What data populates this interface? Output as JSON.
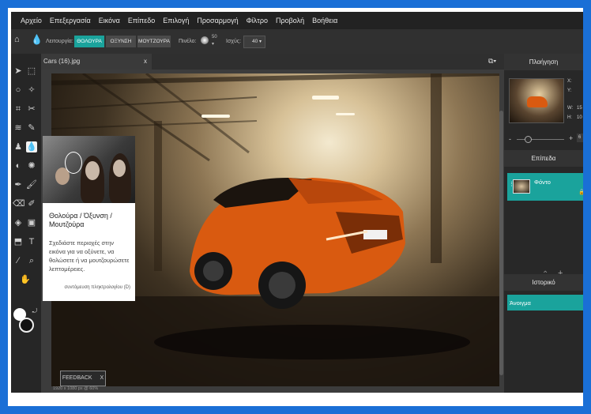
{
  "menu": [
    "Αρχείο",
    "Επεξεργασία",
    "Εικόνα",
    "Επίπεδο",
    "Επιλογή",
    "Προσαρμογή",
    "Φίλτρο",
    "Προβολή",
    "Βοήθεια"
  ],
  "options": {
    "mode_label": "Λειτουργία:",
    "modes": [
      "ΘΟΛΟΥΡΑ",
      "ΟΞΥΝΣΗ",
      "ΜΟΥΤΖΟΥΡΑ"
    ],
    "brush_label": "Πινέλο:",
    "brush_size": "50",
    "strength_label": "Ισχύς:",
    "strength_value": "40"
  },
  "tab": {
    "title": "Cars (16).jpg",
    "close": "x"
  },
  "tooltip": {
    "title": "Θολούρα / Όξυνση / Μουτζούρα",
    "description": "Σχεδιάστε περιοχές στην εικόνα για να οξύνετε, να θολώσετε ή να μουτζουρώσετε λεπτομέρειες.",
    "shortcut": "συντόμευση πληκτρολογίου (D)"
  },
  "feedback": {
    "label": "FEEDBACK",
    "close": "X"
  },
  "status_text": "1920 x 1080 px @ 60%",
  "navigator": {
    "title": "Πλοήγηση",
    "x_label": "X:",
    "y_label": "Y:",
    "w_label": "W:",
    "w_value": "15",
    "h_label": "H:",
    "h_value": "10",
    "zoom_value": "6"
  },
  "layers": {
    "title": "Επίπεδα",
    "items": [
      {
        "name": "Φόντο"
      }
    ]
  },
  "history": {
    "title": "Ιστορικό",
    "items": [
      {
        "name": "Άνοιγμα"
      }
    ]
  },
  "colors": {
    "accent": "#1aa39c",
    "frame": "#1a6fd6"
  }
}
